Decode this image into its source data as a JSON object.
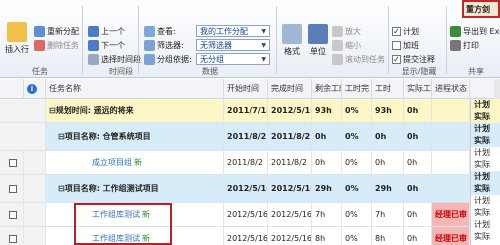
{
  "user": {
    "name": "董方剑"
  },
  "ribbon": {
    "task_group": {
      "insert_label": "插入行",
      "rename_label": "重新分配",
      "delete_label": "删除任务",
      "group_label": "任务"
    },
    "period_group": {
      "up_label": "上一个",
      "down_label": "下一个",
      "select_label": "选择时间段",
      "group_label": "时间段"
    },
    "data_group": {
      "view_label": "查看:",
      "view_value": "我的工作分配",
      "filter_label": "筛选器:",
      "filter_value": "无筛选器",
      "groupby_label": "分组依据:",
      "groupby_value": "无分组",
      "group_label": "数据"
    },
    "format_group": {
      "format_label": "格式",
      "unit_label": "单位"
    },
    "show_group": {
      "zoom_in": "放大",
      "zoom_out": "缩小",
      "scroll_to_task": "滚动到任务"
    },
    "checks": {
      "plan": "计划",
      "overtime": "加班",
      "submit": "提交注释",
      "group_label": "显示/隐藏"
    },
    "share": {
      "export": "导出到 Excel",
      "print": "打印",
      "group_label": "共享"
    }
  },
  "grid": {
    "columns": [
      "任务名称",
      "开始时间",
      "完成时间",
      "剩余工时",
      "工时完",
      "工时",
      "实际工",
      "进程状态"
    ],
    "rows": [
      {
        "type": "y",
        "name": "⊟规划时间: 遥远的将来",
        "start": "2011/7/18",
        "finish": "2012/5/16",
        "remain": "93h",
        "pct": "0%",
        "work": "93h",
        "actual": "0h",
        "status": ""
      },
      {
        "type": "b",
        "name": "⊟项目名称: 仓管系统项目",
        "start": "2011/8/2",
        "finish": "2011/8/2",
        "remain": "0h",
        "pct": "0%",
        "work": "0h",
        "actual": "0h",
        "status": ""
      },
      {
        "type": "w",
        "name": "成立项目组",
        "new": "新",
        "start": "2011/8/2",
        "finish": "2011/8/2",
        "remain": "0h",
        "pct": "0%",
        "work": "0h",
        "actual": "0h",
        "status": ""
      },
      {
        "type": "b",
        "name": "⊟项目名称: 工作组测试项目",
        "start": "2012/5/16",
        "finish": "2012/5/16",
        "remain": "29h",
        "pct": "0%",
        "work": "29h",
        "actual": "0h",
        "status": ""
      },
      {
        "type": "w",
        "name": "工作组库测试",
        "new": "新",
        "start": "2012/5/16",
        "finish": "2012/5/16",
        "remain": "7h",
        "pct": "0%",
        "work": "7h",
        "actual": "0h",
        "status": "经理已审"
      },
      {
        "type": "w",
        "name": "工作组库测试",
        "new": "新",
        "start": "2012/5/16",
        "finish": "2012/5/16",
        "remain": "8h",
        "pct": "0%",
        "work": "8h",
        "actual": "0h",
        "status": "经理已审"
      }
    ],
    "right_col": [
      "计划",
      "实际",
      "计划",
      "实际",
      "计划",
      "实际",
      "计划",
      "实际",
      "计划",
      "实际",
      "计划",
      "实际"
    ]
  }
}
